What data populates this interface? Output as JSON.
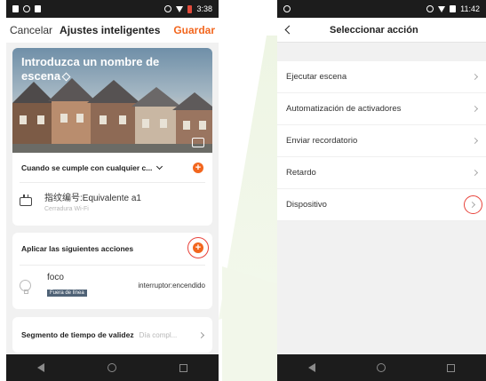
{
  "screen1": {
    "status_time": "3:38",
    "header": {
      "cancel_label": "Cancelar",
      "title": "Ajustes inteligentes",
      "save_label": "Guardar"
    },
    "banner": {
      "name_placeholder": "Introduzca un nombre de escena"
    },
    "condition": {
      "label": "Cuando se cumple con cualquier c...",
      "device_name": "指纹编号:Equivalente a1",
      "device_sub": "Cerradura Wi-Fi"
    },
    "actions": {
      "label": "Aplicar las siguientes acciones",
      "device_name": "foco",
      "device_badge": "Fuera de línea",
      "device_action": "interruptor:encendido"
    },
    "validity": {
      "label": "Segmento de tiempo de validez",
      "value": "Día compl..."
    }
  },
  "screen2": {
    "status_time": "11:42",
    "title": "Seleccionar acción",
    "menu": [
      {
        "label": "Ejecutar escena"
      },
      {
        "label": "Automatización de activadores"
      },
      {
        "label": "Enviar recordatorio"
      },
      {
        "label": "Retardo"
      },
      {
        "label": "Dispositivo"
      }
    ]
  },
  "colors": {
    "accent": "#f2661e",
    "highlight_ring": "#e8423a",
    "bar": "#1c1c1c"
  }
}
